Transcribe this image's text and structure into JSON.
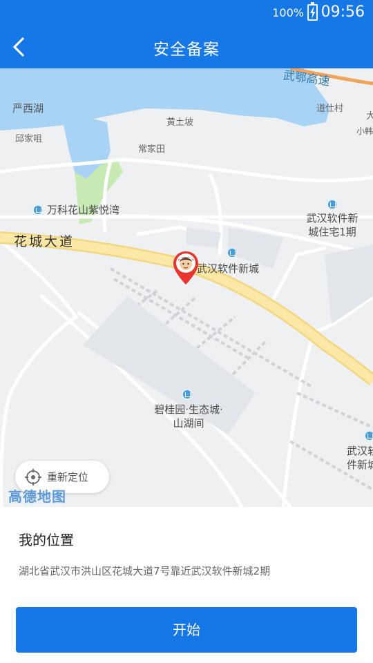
{
  "status_bar": {
    "battery_percent": "100%",
    "battery_icon": "battery-charging-icon",
    "time": "09:56"
  },
  "header": {
    "back_icon": "chevron-left-icon",
    "title": "安全备案"
  },
  "map": {
    "labels": {
      "expressway": "武鄂高速",
      "lake": "严西湖",
      "village_1": "邱家咀",
      "village_2": "黄土坡",
      "village_3": "道仕村",
      "village_4": "常家田",
      "edge_top_right": "大",
      "edge_right_small": "小韩",
      "avenue": "花城大道"
    },
    "pois": {
      "vanke": "万科花山紫悦湾",
      "software_city_housing": "武汉软件新城住宅1期",
      "software_city": "武汉软件新城",
      "country_garden": "碧桂园·生态城·山湖间",
      "edge_poi": "武汉软件新城"
    },
    "relocate_label": "重新定位",
    "logo_text": "高德地图"
  },
  "location": {
    "section_title": "我的位置",
    "address": "湖北省武汉市洪山区花城大道7号靠近武汉软件新城2期"
  },
  "actions": {
    "start_label": "开始"
  },
  "colors": {
    "primary": "#1677e6",
    "water": "#a9d3f5",
    "green": "#c7e9b4",
    "main_road": "#fbe7a6",
    "marker_red": "#e8352e"
  }
}
